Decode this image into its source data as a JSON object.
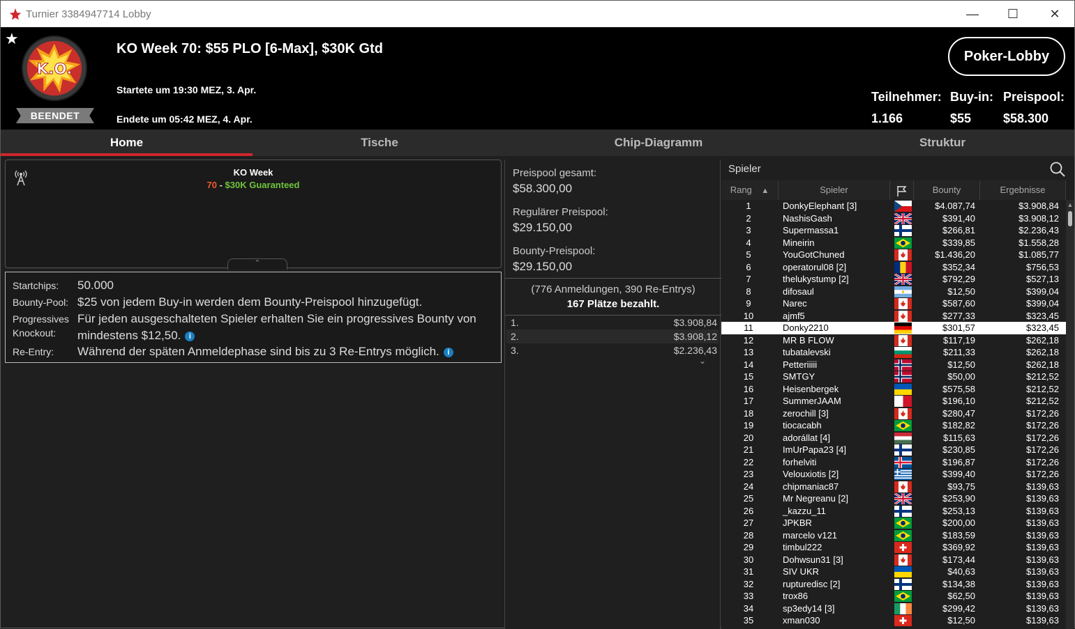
{
  "window": {
    "title": "Turnier 3384947714 Lobby"
  },
  "header": {
    "tournament_name": "KO Week 70: $55 PLO [6-Max], $30K Gtd",
    "started": "Startete um 19:30 MEZ, 3. Apr.",
    "ended": "Endete um 05:42 MEZ, 4. Apr.",
    "status": "BEENDET",
    "logo_text": "K.O.",
    "lobby_button": "Poker-Lobby",
    "stats": {
      "entrants_label": "Teilnehmer:",
      "entrants_value": "1.166",
      "buyin_label": "Buy-in:",
      "buyin_value": "$55",
      "prizepool_label": "Preispool:",
      "prizepool_value": "$58.300"
    }
  },
  "tabs": [
    "Home",
    "Tische",
    "Chip-Diagramm",
    "Struktur"
  ],
  "info_panel": {
    "title": "KO Week",
    "subtitle_num": "70",
    "subtitle_sep": " - ",
    "subtitle_text": "$30K Guaranteed"
  },
  "rules": {
    "startchips_label": "Startchips:",
    "startchips_value": "50.000",
    "bounty_label": "Bounty-Pool:",
    "bounty_value": "$25 von jedem Buy-in werden dem Bounty-Preispool hinzugefügt.",
    "pko_label_1": "Progressives",
    "pko_label_2": "Knockout:",
    "pko_value_1": "Für jeden ausgeschalteten Spieler erhalten Sie ein progressives Bounty von",
    "pko_value_2": "mindestens $12,50.",
    "reentry_label": "Re-Entry:",
    "reentry_value": "Während der späten Anmeldephase sind bis zu 3 Re-Entrys möglich."
  },
  "prizepool": {
    "total_label": "Preispool gesamt:",
    "total_value": "$58.300,00",
    "regular_label": "Regulärer Preispool:",
    "regular_value": "$29.150,00",
    "bounty_label": "Bounty-Preispool:",
    "bounty_value": "$29.150,00",
    "registrations": "(776 Anmeldungen, 390 Re-Entrys)",
    "paid": "167 Plätze bezahlt.",
    "payouts": [
      {
        "place": "1.",
        "amount": "$3.908,84"
      },
      {
        "place": "2.",
        "amount": "$3.908,12"
      },
      {
        "place": "3.",
        "amount": "$2.236,43"
      }
    ]
  },
  "players": {
    "title": "Spieler",
    "columns": [
      "Rang",
      "Spieler",
      "Bounty",
      "Ergebnisse"
    ],
    "highlight_rank": "11",
    "rows": [
      {
        "rank": "1",
        "name": "DonkyElephant [3]",
        "flag": "cz",
        "bounty": "$4.087,74",
        "result": "$3.908,84"
      },
      {
        "rank": "2",
        "name": "NashisGash",
        "flag": "gb",
        "bounty": "$391,40",
        "result": "$3.908,12"
      },
      {
        "rank": "3",
        "name": "Supermassa1",
        "flag": "fi",
        "bounty": "$266,81",
        "result": "$2.236,43"
      },
      {
        "rank": "4",
        "name": "Mineirin",
        "flag": "br",
        "bounty": "$339,85",
        "result": "$1.558,28"
      },
      {
        "rank": "5",
        "name": "YouGotChuned",
        "flag": "ca",
        "bounty": "$1.436,20",
        "result": "$1.085,77"
      },
      {
        "rank": "6",
        "name": "operatorul08 [2]",
        "flag": "ro",
        "bounty": "$352,34",
        "result": "$756,53"
      },
      {
        "rank": "7",
        "name": "thelukystump [2]",
        "flag": "gb",
        "bounty": "$792,29",
        "result": "$527,13"
      },
      {
        "rank": "8",
        "name": "difosaul",
        "flag": "ar",
        "bounty": "$12,50",
        "result": "$399,04"
      },
      {
        "rank": "9",
        "name": "Narec",
        "flag": "ca",
        "bounty": "$587,60",
        "result": "$399,04"
      },
      {
        "rank": "10",
        "name": "ajmf5",
        "flag": "ca",
        "bounty": "$277,33",
        "result": "$323,45"
      },
      {
        "rank": "11",
        "name": "Donky2210",
        "flag": "de",
        "bounty": "$301,57",
        "result": "$323,45"
      },
      {
        "rank": "12",
        "name": "MR B FLOW",
        "flag": "ca",
        "bounty": "$117,19",
        "result": "$262,18"
      },
      {
        "rank": "13",
        "name": "tubatalevski",
        "flag": "bg",
        "bounty": "$211,33",
        "result": "$262,18"
      },
      {
        "rank": "14",
        "name": "Petteriiiii",
        "flag": "no",
        "bounty": "$12,50",
        "result": "$262,18"
      },
      {
        "rank": "15",
        "name": "SMTGY",
        "flag": "no",
        "bounty": "$50,00",
        "result": "$212,52"
      },
      {
        "rank": "16",
        "name": "Heisenbergek",
        "flag": "ua",
        "bounty": "$575,58",
        "result": "$212,52"
      },
      {
        "rank": "17",
        "name": "SummerJAAM",
        "flag": "mt",
        "bounty": "$196,10",
        "result": "$212,52"
      },
      {
        "rank": "18",
        "name": "zerochill [3]",
        "flag": "ca",
        "bounty": "$280,47",
        "result": "$172,26"
      },
      {
        "rank": "19",
        "name": "tiocacabh",
        "flag": "br",
        "bounty": "$182,82",
        "result": "$172,26"
      },
      {
        "rank": "20",
        "name": "adorállat [4]",
        "flag": "hu",
        "bounty": "$115,63",
        "result": "$172,26"
      },
      {
        "rank": "21",
        "name": "ImUrPapa23 [4]",
        "flag": "fi",
        "bounty": "$230,85",
        "result": "$172,26"
      },
      {
        "rank": "22",
        "name": "forhelviti",
        "flag": "is",
        "bounty": "$196,87",
        "result": "$172,26"
      },
      {
        "rank": "23",
        "name": "Velouxiotis [2]",
        "flag": "gr",
        "bounty": "$399,40",
        "result": "$172,26"
      },
      {
        "rank": "24",
        "name": "chipmaniac87",
        "flag": "ca",
        "bounty": "$93,75",
        "result": "$139,63"
      },
      {
        "rank": "25",
        "name": "Mr Negreanu [2]",
        "flag": "gb",
        "bounty": "$253,90",
        "result": "$139,63"
      },
      {
        "rank": "26",
        "name": "_kazzu_11",
        "flag": "fi",
        "bounty": "$253,13",
        "result": "$139,63"
      },
      {
        "rank": "27",
        "name": "JPKBR",
        "flag": "br",
        "bounty": "$200,00",
        "result": "$139,63"
      },
      {
        "rank": "28",
        "name": "marcelo v121",
        "flag": "br",
        "bounty": "$183,59",
        "result": "$139,63"
      },
      {
        "rank": "29",
        "name": "timbul222",
        "flag": "ch",
        "bounty": "$369,92",
        "result": "$139,63"
      },
      {
        "rank": "30",
        "name": "Dohwsun31 [3]",
        "flag": "ca",
        "bounty": "$173,44",
        "result": "$139,63"
      },
      {
        "rank": "31",
        "name": "SIV UKR",
        "flag": "ua",
        "bounty": "$40,63",
        "result": "$139,63"
      },
      {
        "rank": "32",
        "name": "rupturedisc [2]",
        "flag": "fi",
        "bounty": "$134,38",
        "result": "$139,63"
      },
      {
        "rank": "33",
        "name": "trox86",
        "flag": "br",
        "bounty": "$62,50",
        "result": "$139,63"
      },
      {
        "rank": "34",
        "name": "sp3edy14 [3]",
        "flag": "ie",
        "bounty": "$299,42",
        "result": "$139,63"
      },
      {
        "rank": "35",
        "name": "xman030",
        "flag": "ch",
        "bounty": "$12,50",
        "result": "$139,63"
      }
    ]
  },
  "colors": {
    "accent_red": "#d0262d",
    "green": "#6fc53c",
    "orange": "#f05a28",
    "highlight_row": "#ffffff"
  }
}
